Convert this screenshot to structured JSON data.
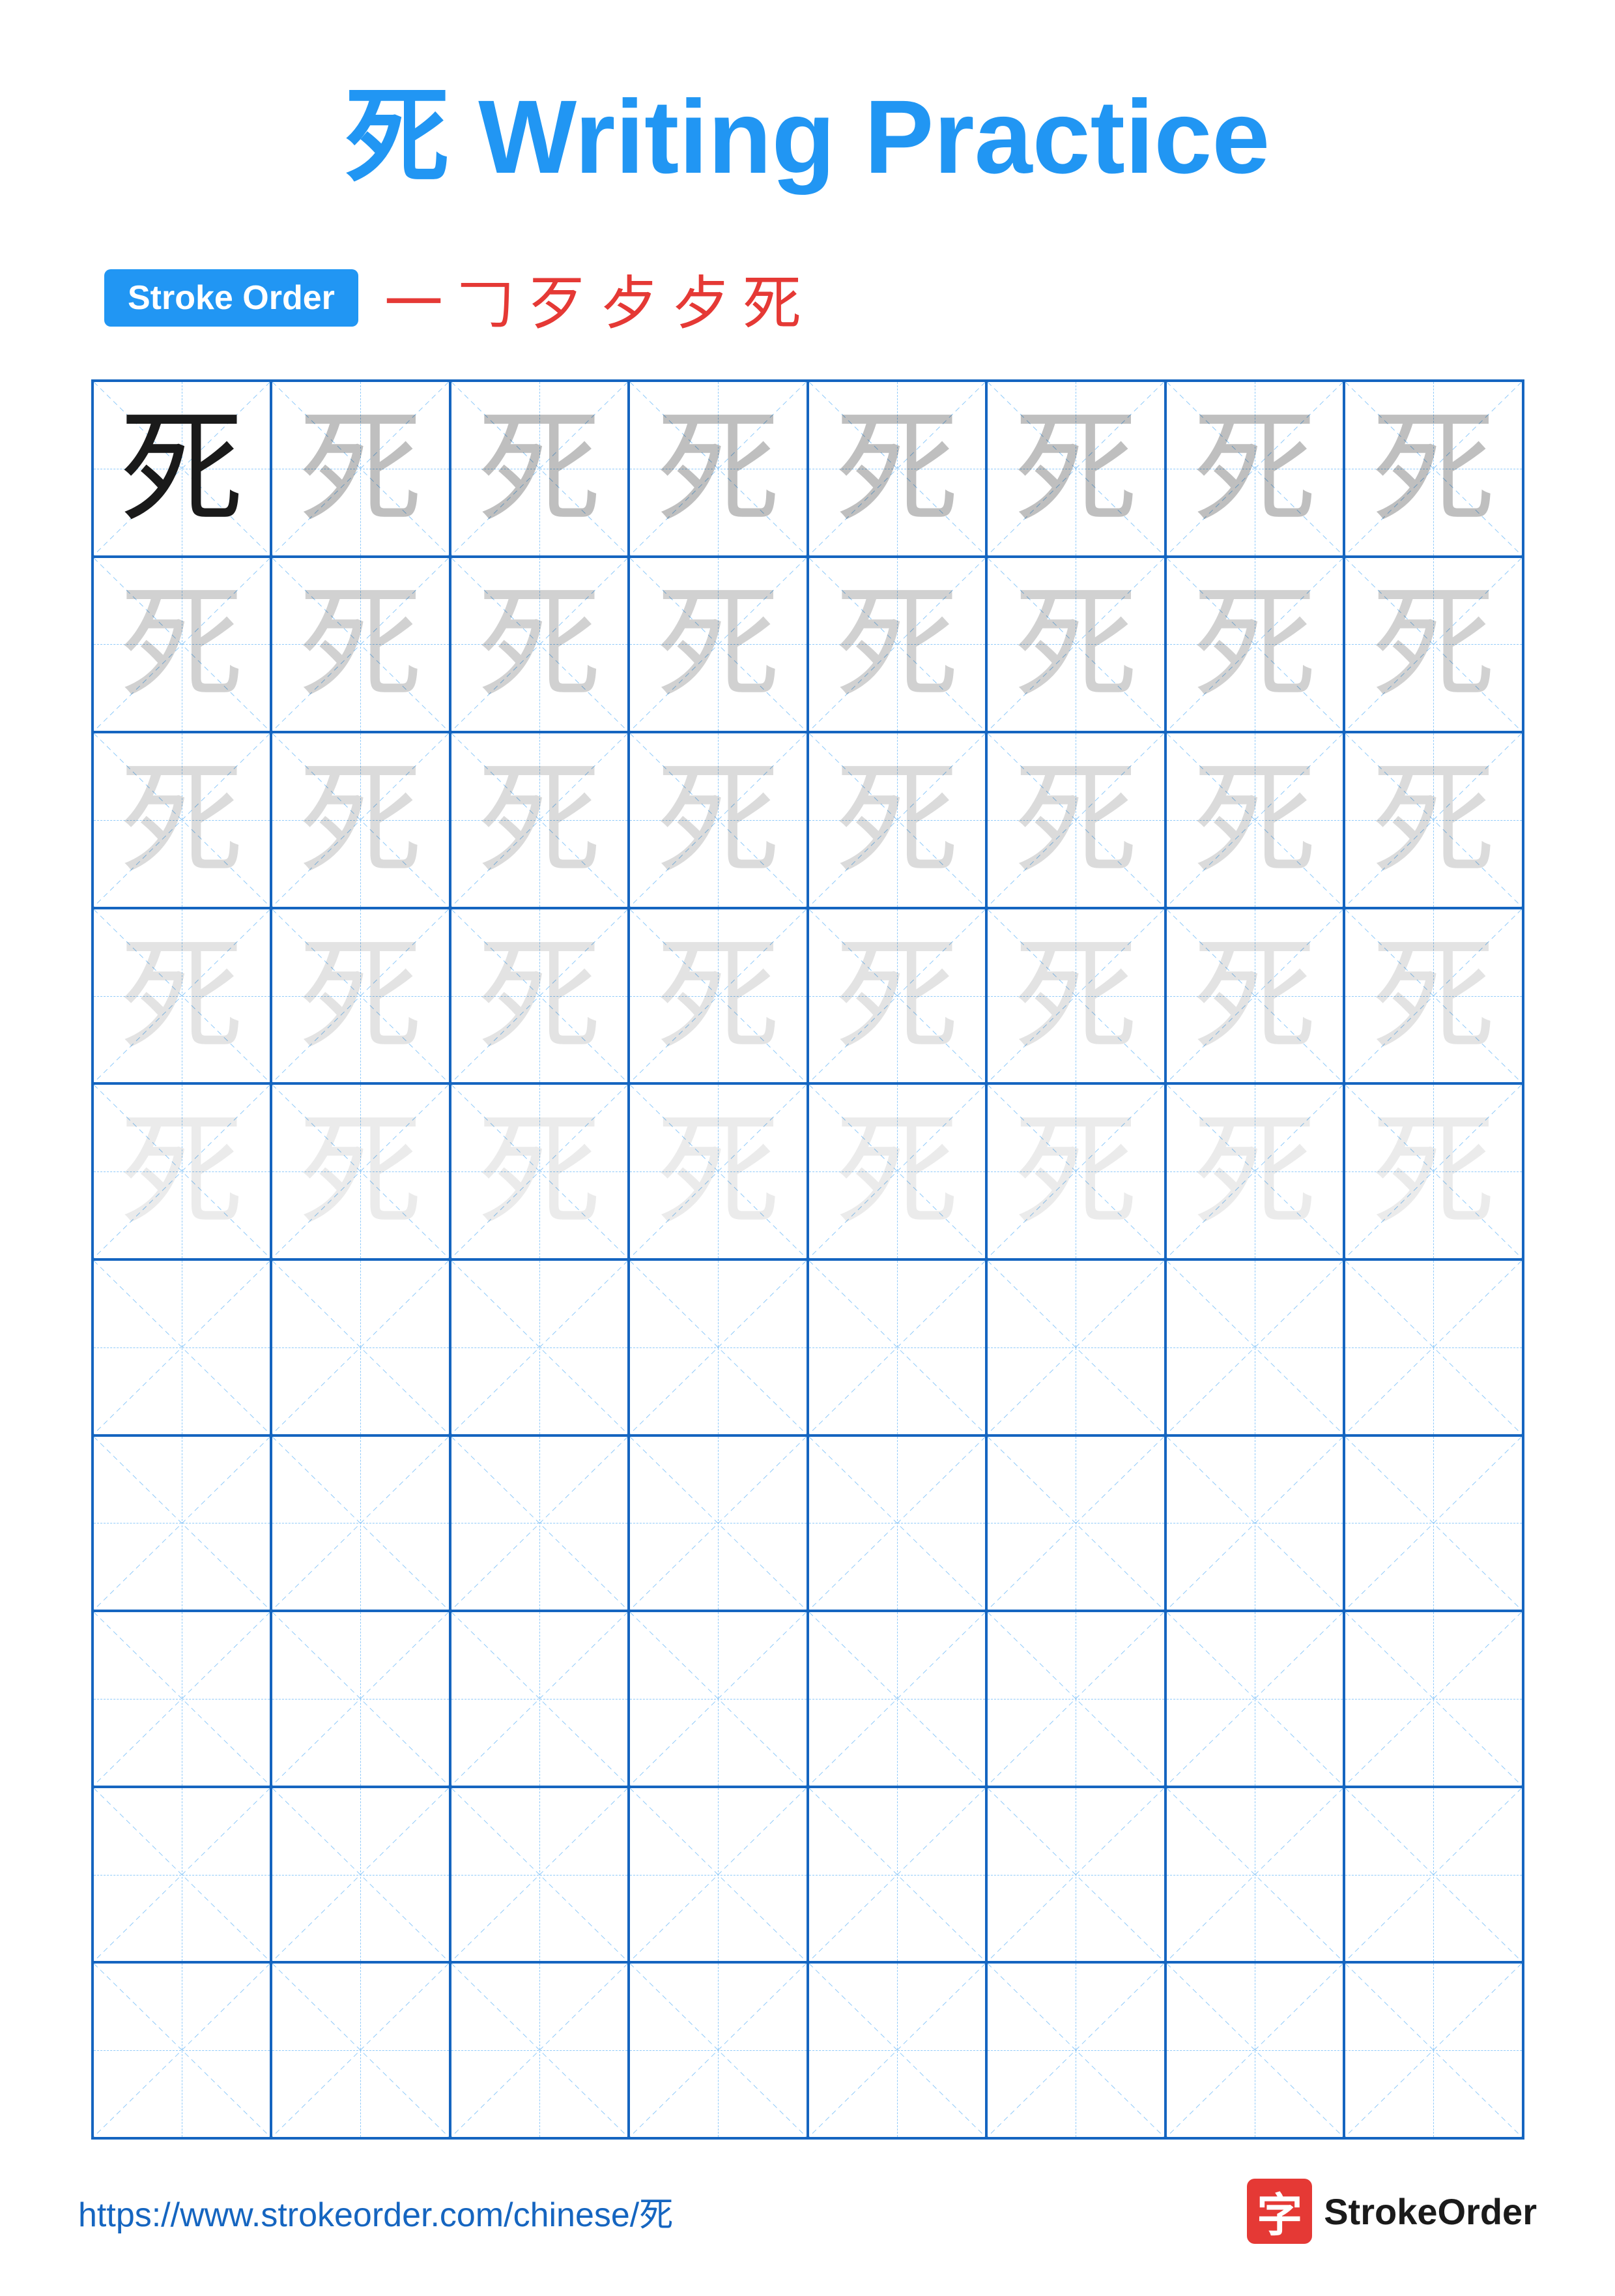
{
  "title": "死 Writing Practice",
  "stroke_order": {
    "badge_label": "Stroke Order",
    "strokes": [
      "一",
      "𠃌",
      "歹",
      "歺",
      "歺",
      "死"
    ]
  },
  "character": "死",
  "grid": {
    "cols": 8,
    "rows": 10,
    "practice_rows": 5,
    "empty_rows": 5
  },
  "footer": {
    "url": "https://www.strokeorder.com/chinese/死",
    "brand": "StrokeOrder"
  }
}
